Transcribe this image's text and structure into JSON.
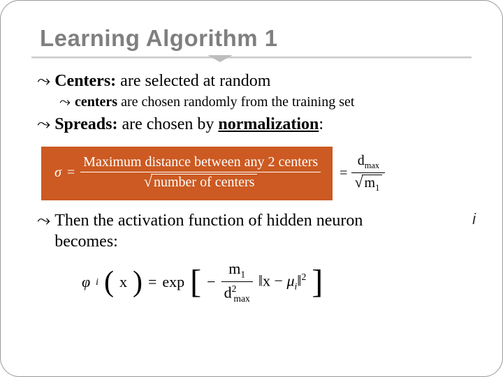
{
  "title": "Learning Algorithm 1",
  "bullets": {
    "glyph": "⤳",
    "l1_centers": {
      "bold": "Centers:",
      "rest": " are selected at random"
    },
    "l2_centers": {
      "bold": "centers",
      "rest": " are chosen randomly from the training set"
    },
    "l1_spreads": {
      "bold": "Spreads:",
      "rest_a": " are chosen by ",
      "rest_b_u": "normalization",
      "rest_c": ":"
    },
    "l1_then": {
      "txt_a": "Then the activation function of hidden neuron",
      "txt_b": "becomes:"
    }
  },
  "formula_main": {
    "sigma": "σ",
    "eq": "=",
    "num": "Maximum distance between any 2 centers",
    "den_sqrt": "number of centers"
  },
  "formula_side": {
    "eq": "=",
    "num": "d",
    "num_sub": "max",
    "den_sqrt": "m",
    "den_sqrt_sub": "1"
  },
  "phi": {
    "phi": "φ",
    "i": "i",
    "x": "x",
    "eq": "=",
    "exp": "exp",
    "minus": "−",
    "m": "m",
    "m_sub": "1",
    "d": "d",
    "d_sub": "max",
    "d_sup": "2",
    "mu": "μ",
    "norm_sup": "2"
  },
  "float_i": "i"
}
